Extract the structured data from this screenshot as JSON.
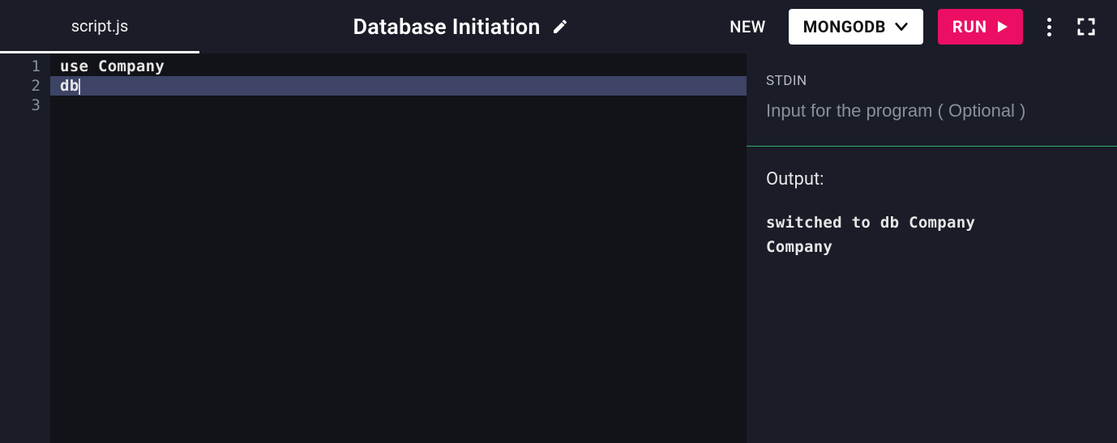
{
  "toolbar": {
    "tab_label": "script.js",
    "title": "Database Initiation",
    "new_label": "NEW",
    "language_label": "MONGODB",
    "run_label": "RUN"
  },
  "editor": {
    "lines": [
      {
        "num": "1",
        "text": "use Company",
        "highlight": false,
        "cursor": false
      },
      {
        "num": "2",
        "text": "db",
        "highlight": true,
        "cursor": true
      },
      {
        "num": "3",
        "text": "",
        "highlight": false,
        "cursor": false
      }
    ]
  },
  "stdin": {
    "label": "STDIN",
    "placeholder": "Input for the program ( Optional )",
    "value": ""
  },
  "output": {
    "label": "Output:",
    "text": "switched to db Company\nCompany"
  }
}
